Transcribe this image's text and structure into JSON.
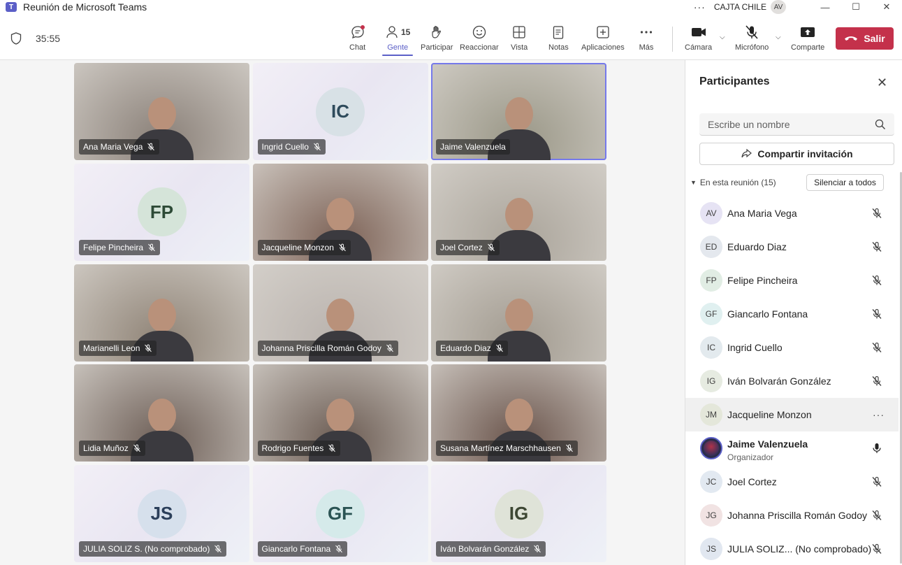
{
  "window": {
    "title": "Reunión de Microsoft Teams",
    "org": "CAJTA CHILE",
    "user_initials": "AV",
    "more": "···",
    "minimize": "—",
    "maximize": "☐",
    "close": "✕"
  },
  "toolbar": {
    "timer": "35:55",
    "buttons": {
      "chat": "Chat",
      "people": "Gente",
      "people_count": "15",
      "raise": "Participar",
      "react": "Reaccionar",
      "view": "Vista",
      "notes": "Notas",
      "apps": "Aplicaciones",
      "more": "Más",
      "camera": "Cámara",
      "mic": "Micrófono",
      "share": "Comparte"
    },
    "leave": "Salir",
    "accent": "#5b5fc7",
    "leave_color": "#c4314b"
  },
  "grid": [
    {
      "name": "Ana Maria Vega",
      "type": "video",
      "bg": "#8a8078"
    },
    {
      "name": "Ingrid Cuello",
      "type": "avatar",
      "initials": "IC",
      "av_bg": "#d8e1e6",
      "av_fg": "#2f4b5c"
    },
    {
      "name": "Jaime Valenzuela",
      "type": "video",
      "bg": "#9a9787",
      "speaking": true
    },
    {
      "name": "Felipe Pincheira",
      "type": "avatar",
      "initials": "FP",
      "av_bg": "#d5e4d9",
      "av_fg": "#2d4a36"
    },
    {
      "name": "Jacqueline Monzon",
      "type": "video",
      "bg": "#7d6256"
    },
    {
      "name": "Joel Cortez",
      "type": "video",
      "bg": "#aaa49a"
    },
    {
      "name": "Marianelli Leon",
      "type": "video",
      "bg": "#8f8376"
    },
    {
      "name": "Johanna Priscilla Román Godoy",
      "type": "video",
      "bg": "#b9b2ad"
    },
    {
      "name": "Eduardo Diaz",
      "type": "video",
      "bg": "#a19a8f"
    },
    {
      "name": "Lidia Muñoz",
      "type": "video",
      "bg": "#6e5f57"
    },
    {
      "name": "Rodrigo Fuentes",
      "type": "video",
      "bg": "#6b5b52"
    },
    {
      "name": "Susana Martínez Marschhausen",
      "type": "video",
      "bg": "#6a544b"
    },
    {
      "name": "JULIA SOLIZ S. (No comprobado)",
      "type": "avatar",
      "initials": "JS",
      "av_bg": "#d6e0ec",
      "av_fg": "#2b3f5a"
    },
    {
      "name": "Giancarlo Fontana",
      "type": "avatar",
      "initials": "GF",
      "av_bg": "#d5eaea",
      "av_fg": "#2b5454"
    },
    {
      "name": "Iván Bolvarán González",
      "type": "avatar",
      "initials": "IG",
      "av_bg": "#dfe3d8",
      "av_fg": "#3d4733"
    }
  ],
  "panel": {
    "title": "Participantes",
    "close": "✕",
    "search_placeholder": "Escribe un nombre",
    "share_invite": "Compartir invitación",
    "section": "En esta reunión (15)",
    "mute_all": "Silenciar a todos",
    "participants": [
      {
        "initials": "AV",
        "name": "Ana Maria Vega",
        "bg": "#e6e3f4"
      },
      {
        "initials": "ED",
        "name": "Eduardo Diaz",
        "bg": "#e4e8ee"
      },
      {
        "initials": "FP",
        "name": "Felipe Pincheira",
        "bg": "#e1ede4"
      },
      {
        "initials": "GF",
        "name": "Giancarlo Fontana",
        "bg": "#e0f0f0"
      },
      {
        "initials": "IC",
        "name": "Ingrid Cuello",
        "bg": "#e3eaee"
      },
      {
        "initials": "IG",
        "name": "Iván Bolvarán González",
        "bg": "#e6ebe1"
      },
      {
        "initials": "JM",
        "name": "Jacqueline Monzon",
        "bg": "#e4e7da",
        "hover": true,
        "more": "···"
      },
      {
        "initials": "",
        "name": "Jaime Valenzuela",
        "role": "Organizador",
        "bg": "#2b2d4a",
        "photo": true,
        "mic_on": true
      },
      {
        "initials": "JC",
        "name": "Joel Cortez",
        "bg": "#e2e9f1"
      },
      {
        "initials": "JG",
        "name": "Johanna Priscilla Román Godoy",
        "bg": "#f1e3e3"
      },
      {
        "initials": "JS",
        "name": "JULIA SOLIZ... (No comprobado)",
        "bg": "#e1e7f0"
      }
    ]
  }
}
